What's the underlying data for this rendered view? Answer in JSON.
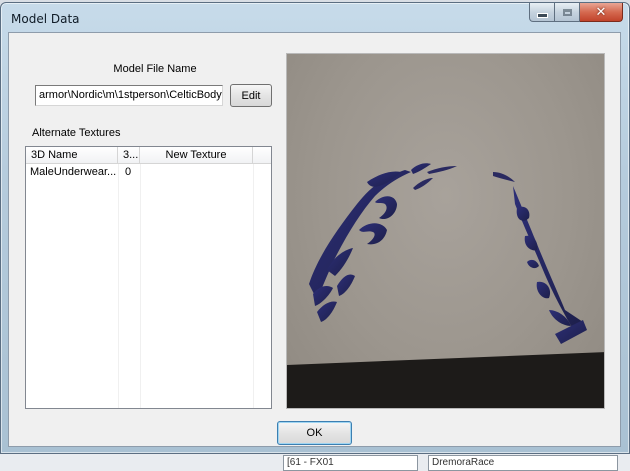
{
  "window": {
    "title": "Model Data"
  },
  "model_file": {
    "label": "Model File Name",
    "value": "armor\\Nordic\\m\\1stperson\\CelticBody",
    "edit_label": "Edit"
  },
  "alternate_textures": {
    "label": "Alternate Textures",
    "columns": [
      "3D Name",
      "3...",
      "New Texture"
    ],
    "rows": [
      {
        "name": "MaleUnderwear...",
        "index": "0",
        "texture": ""
      }
    ]
  },
  "ok_label": "OK",
  "background": {
    "field_left": "[61 - FX01",
    "field_right": "DremoraRace"
  },
  "colors": {
    "preview_bg": "#9c968e",
    "tattoo": "#2a2a6e",
    "floor": "#1d1b19"
  }
}
